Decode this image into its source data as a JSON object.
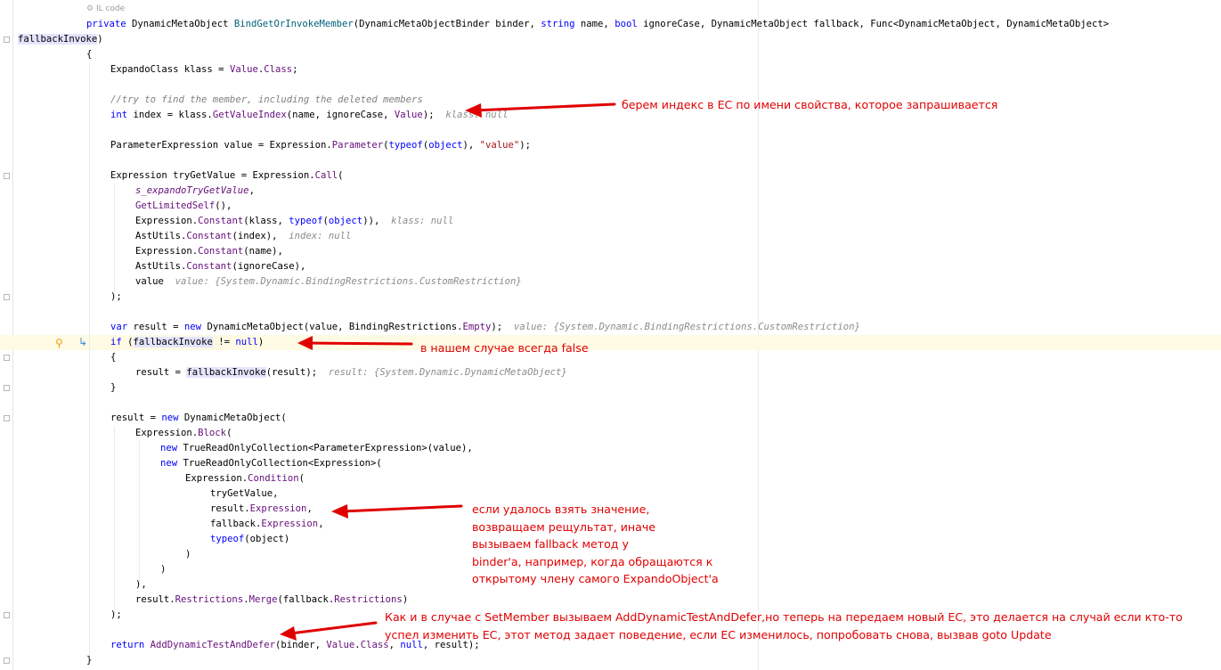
{
  "editor": {
    "il_code_label": "IL code",
    "lines": {
      "sig": {
        "kw_private": "private",
        "type_ret": " DynamicMetaObject ",
        "method_name": "BindGetOrInvokeMember",
        "params_a": "(DynamicMetaObjectBinder binder, ",
        "kw_string": "string",
        "params_b": " name, ",
        "kw_bool": "bool",
        "params_c": " ignoreCase, DynamicMetaObject fallback, Func<DynamicMetaObject, DynamicMetaObject>"
      },
      "sig2": {
        "param": "fallbackInvoke",
        "close": ")"
      },
      "open_brace": "{",
      "klass_a": "ExpandoClass klass = ",
      "klass_value": "Value",
      "klass_dot": ".",
      "klass_class": "Class",
      "klass_semi": ";",
      "comment": "//try to find the member, including the deleted members",
      "idx_kw": "int",
      "idx_a": " index = klass.",
      "idx_method": "GetValueIndex",
      "idx_b": "(name, ignoreCase, ",
      "idx_value": "Value",
      "idx_c": ");",
      "idx_hint": "klass: null",
      "pe_a": "ParameterExpression value = Expression.",
      "pe_method": "Parameter",
      "pe_b": "(",
      "pe_typeof": "typeof",
      "pe_c": "(",
      "pe_object": "object",
      "pe_d": "), ",
      "pe_str": "\"value\"",
      "pe_e": ");",
      "tgv_a": "Expression tryGetValue = Expression.",
      "tgv_call": "Call",
      "tgv_b": "(",
      "arg1": "s_expandoTryGetValue",
      "arg1_tail": ",",
      "arg2": "GetLimitedSelf",
      "arg2_tail": "(),",
      "arg3_a": "Expression.",
      "arg3_m": "Constant",
      "arg3_b": "(klass, ",
      "arg3_typeof": "typeof",
      "arg3_c": "(",
      "arg3_obj": "object",
      "arg3_d": ")),",
      "arg3_hint": "klass: null",
      "arg4_a": "AstUtils.",
      "arg4_m": "Constant",
      "arg4_b": "(index),",
      "arg4_hint": "index: null",
      "arg5_a": "Expression.",
      "arg5_m": "Constant",
      "arg5_b": "(name),",
      "arg6_a": "AstUtils.",
      "arg6_m": "Constant",
      "arg6_b": "(ignoreCase),",
      "arg7": "value",
      "arg7_hint": "value: {System.Dynamic.BindingRestrictions.CustomRestriction}",
      "close_call": ");",
      "var_kw": "var",
      "var_a": " result = ",
      "var_new": "new",
      "var_b": " DynamicMetaObject(value, BindingRestrictions.",
      "var_empty": "Empty",
      "var_c": ");",
      "var_hint": "value: {System.Dynamic.BindingRestrictions.CustomRestriction}",
      "if_kw": "if",
      "if_a": " (",
      "if_var": "fallbackInvoke",
      "if_b": " != ",
      "if_null": "null",
      "if_c": ")",
      "if_open": "{",
      "res_a": "result = ",
      "res_fi": "fallbackInvoke",
      "res_b": "(result);",
      "res_hint": "result: {System.Dynamic.DynamicMetaObject}",
      "if_close": "}",
      "r2_a": "result = ",
      "r2_new": "new",
      "r2_b": " DynamicMetaObject(",
      "blk_a": "Expression.",
      "blk_m": "Block",
      "blk_b": "(",
      "tr1_new": "new",
      "tr1_a": " TrueReadOnlyCollection<ParameterExpression>(value),",
      "tr2_new": "new",
      "tr2_a": " TrueReadOnlyCollection<Expression>(",
      "cond_a": "Expression.",
      "cond_m": "Condition",
      "cond_b": "(",
      "c1": "tryGetValue,",
      "c2_a": "result.",
      "c2_m": "Expression",
      "c2_b": ",",
      "c3_a": "fallback.",
      "c3_m": "Expression",
      "c3_b": ",",
      "c4_kw": "typeof",
      "c4_a": "(object)",
      "close1": ")",
      "close2": ")",
      "close3": "),",
      "rm_a": "result.",
      "rm_m": "Restrictions",
      "rm_b": ".",
      "rm_merge": "Merge",
      "rm_c": "(fallback.",
      "rm_r": "Restrictions",
      "rm_d": ")",
      "close4": ");",
      "ret_kw": "return",
      "ret_a": " ",
      "ret_m": "AddDynamicTestAndDefer",
      "ret_b": "(binder, ",
      "ret_value": "Value",
      "ret_c": ".",
      "ret_class": "Class",
      "ret_d": ", ",
      "ret_null": "null",
      "ret_e": ", result);",
      "close_brace": "}"
    }
  },
  "annotations": {
    "a1": "берем индекс в ЕС по имени свойства, которое запрашивается",
    "a2": "в нашем случае всегда false",
    "a3": [
      "если удалось взять значение,",
      "возвращаем рещультат, иначе",
      "вызываем fallback метод у",
      "binder'a, например, когда обращаются к",
      "открытому члену самого ExpandoObject'a"
    ],
    "a4": [
      "Как и в случае с SetMember вызываем AddDynamicTestAndDefer,но теперь на передаем новый ЕС, это делается на случай если кто-то",
      "успел изменить ЕС, этот метод задает поведение, если ЕС изменилось, попробовать снова, вызвав goto Update"
    ]
  },
  "colors": {
    "annotation": "#e00000",
    "keyword": "#0000ff",
    "member": "#660e7a",
    "string": "#a31515",
    "hint": "#8c8c8c",
    "caret_row": "#fffae3"
  },
  "icons": [
    "il-code-icon",
    "lightbulb-icon",
    "step-into-icon"
  ]
}
